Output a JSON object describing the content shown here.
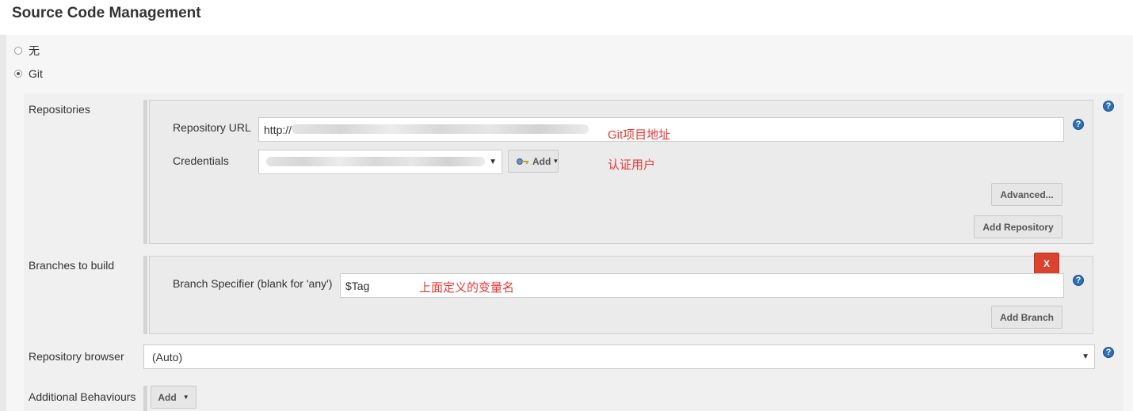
{
  "header": {
    "title": "Source Code Management"
  },
  "scm_options": [
    {
      "label": "无",
      "selected": false
    },
    {
      "label": "Git",
      "selected": true
    }
  ],
  "repositories": {
    "label": "Repositories",
    "url_label": "Repository URL",
    "url_value": "http://",
    "url_annotation": "Git项目地址",
    "credentials_label": "Credentials",
    "credentials_annotation": "认证用户",
    "add_label": "Add",
    "advanced_label": "Advanced...",
    "add_repository_label": "Add Repository"
  },
  "branches": {
    "label": "Branches to build",
    "specifier_label": "Branch Specifier (blank for 'any')",
    "specifier_value": "$Tag",
    "specifier_annotation": "上面定义的变量名",
    "delete_label": "X",
    "add_branch_label": "Add Branch"
  },
  "browser": {
    "label": "Repository browser",
    "value": "(Auto)"
  },
  "behaviours": {
    "label": "Additional Behaviours",
    "add_label": "Add"
  },
  "help_glyph": "?",
  "icons": {
    "help": "help-icon",
    "key": "key-icon",
    "dropdown": "chevron-down-icon"
  },
  "colors": {
    "annotation": "#e53935",
    "delete_button": "#d9432f",
    "help": "#2f6fb5"
  }
}
